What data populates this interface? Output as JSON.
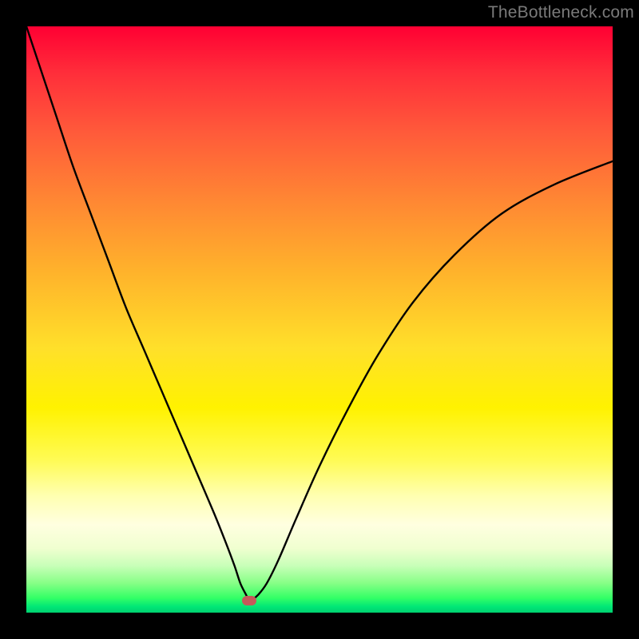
{
  "watermark": {
    "text": "TheBottleneck.com"
  },
  "chart_data": {
    "type": "line",
    "title": "",
    "xlabel": "",
    "ylabel": "",
    "xlim": [
      0,
      100
    ],
    "ylim": [
      0,
      100
    ],
    "grid": false,
    "legend": false,
    "minimum_marker": {
      "x": 38,
      "y": 2
    },
    "series": [
      {
        "name": "bottleneck-curve",
        "x": [
          0,
          2,
          5,
          8,
          11,
          14,
          17,
          20,
          23,
          26,
          29,
          32,
          34,
          35.5,
          36.5,
          37.5,
          38,
          38.5,
          39.5,
          41,
          43,
          46,
          50,
          55,
          60,
          66,
          73,
          81,
          90,
          100
        ],
        "y": [
          100,
          94,
          85,
          76,
          68,
          60,
          52,
          45,
          38,
          31,
          24,
          17,
          12,
          8,
          5,
          3,
          2,
          2.2,
          3,
          5,
          9,
          16,
          25,
          35,
          44,
          53,
          61,
          68,
          73,
          77
        ]
      }
    ],
    "background": {
      "type": "vertical-gradient",
      "stops": [
        {
          "pos": 0.0,
          "color": "#ff0033"
        },
        {
          "pos": 0.3,
          "color": "#ff8833"
        },
        {
          "pos": 0.55,
          "color": "#ffe02a"
        },
        {
          "pos": 0.8,
          "color": "#ffffb0"
        },
        {
          "pos": 0.95,
          "color": "#86ff86"
        },
        {
          "pos": 1.0,
          "color": "#00d070"
        }
      ]
    }
  }
}
